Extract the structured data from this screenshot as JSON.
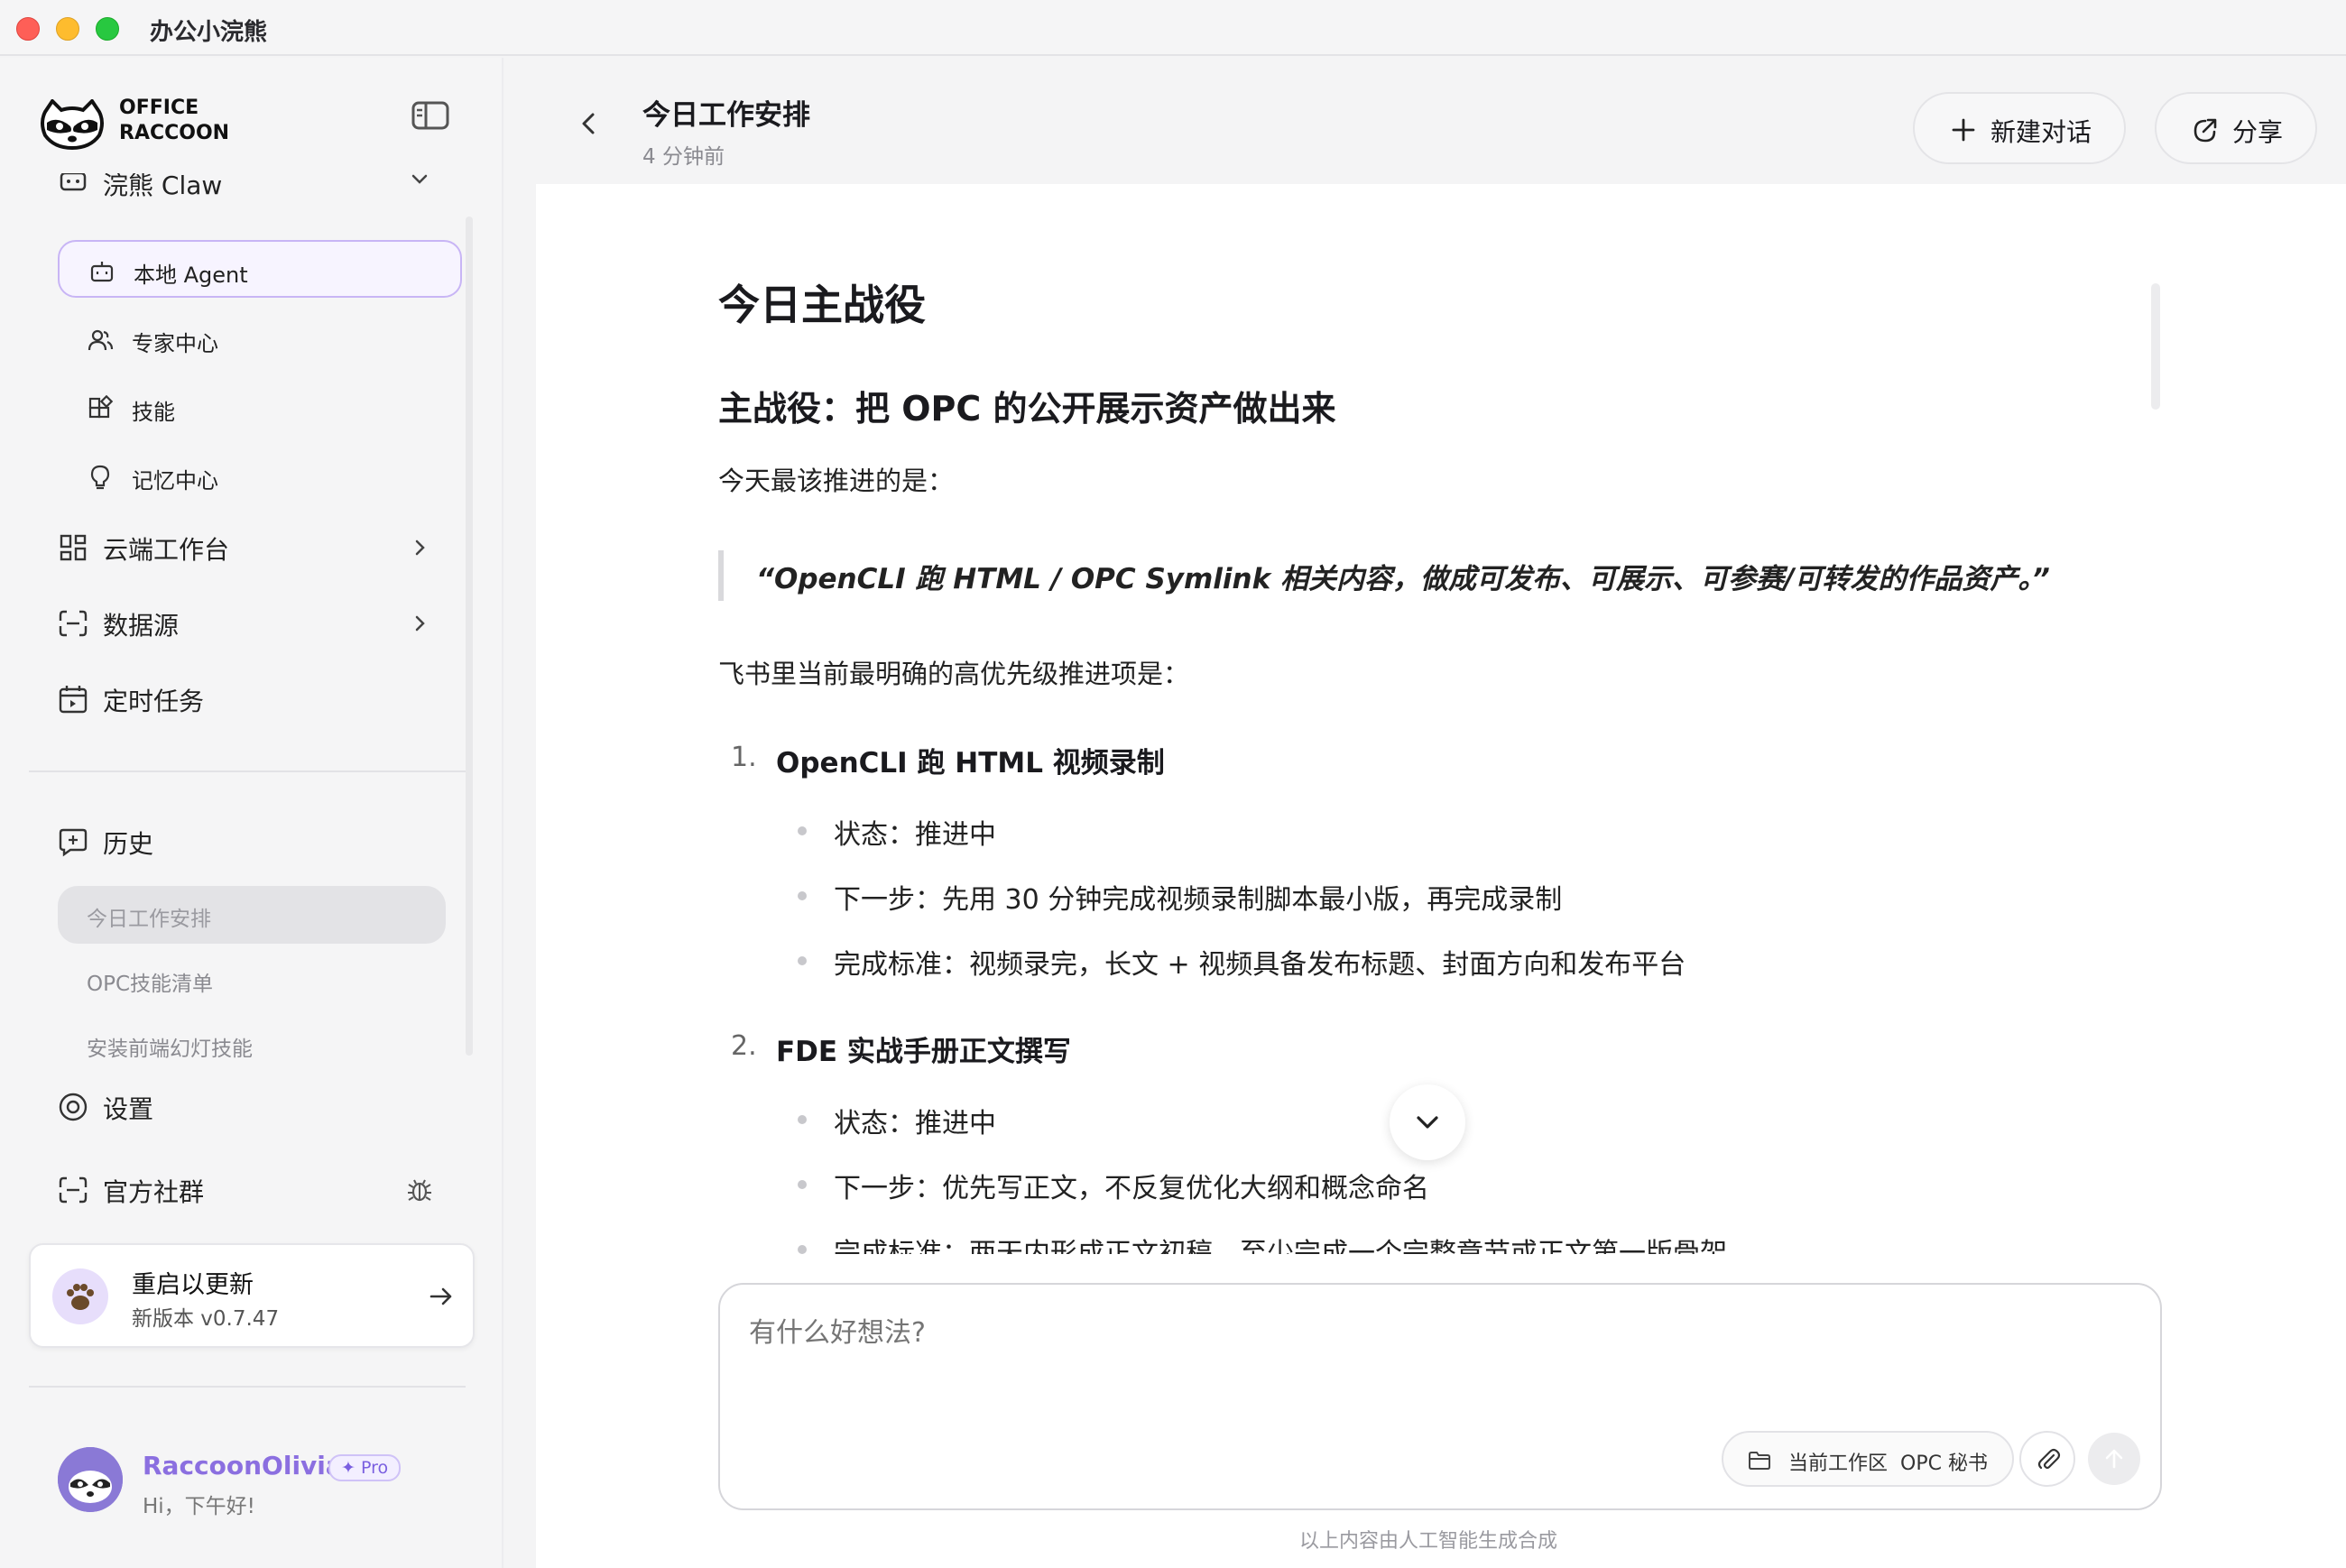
{
  "window": {
    "title": "办公小浣熊"
  },
  "sidebar": {
    "logo": {
      "line1": "OFFICE",
      "line2": "RACCOON"
    },
    "claw": {
      "label": "浣熊 Claw"
    },
    "claw_items": [
      {
        "label": "本地 Agent",
        "icon": "bot-icon",
        "active": true
      },
      {
        "label": "专家中心",
        "icon": "users-icon"
      },
      {
        "label": "技能",
        "icon": "skills-icon"
      },
      {
        "label": "记忆中心",
        "icon": "bulb-icon"
      }
    ],
    "nav": [
      {
        "label": "云端工作台",
        "icon": "grid-icon",
        "chevron": true
      },
      {
        "label": "数据源",
        "icon": "data-source-icon",
        "chevron": true
      },
      {
        "label": "定时任务",
        "icon": "calendar-icon",
        "chevron": false
      }
    ],
    "history": {
      "label": "历史",
      "items": [
        {
          "label": "今日工作安排",
          "active": true
        },
        {
          "label": "OPC技能清单"
        },
        {
          "label": "安装前端幻灯技能"
        }
      ]
    },
    "settings": {
      "label": "设置"
    },
    "community": {
      "label": "官方社群"
    },
    "update": {
      "title": "重启以更新",
      "subtitle": "新版本 v0.7.47"
    },
    "user": {
      "name": "RaccoonOlivia",
      "badge": "Pro",
      "greeting": "Hi，下午好!"
    }
  },
  "chat": {
    "title": "今日工作安排",
    "time": "4 分钟前",
    "new_chat": "新建对话",
    "share": "分享"
  },
  "message": {
    "h1": "今日主战役",
    "h2": "主战役：把 OPC 的公开展示资产做出来",
    "intro": "今天最该推进的是：",
    "quote": "“OpenCLI 跑 HTML / OPC Symlink 相关内容，做成可发布、可展示、可参赛/可转发的作品资产。”",
    "lead": "飞书里当前最明确的高优先级推进项是：",
    "items": [
      {
        "num": "1.",
        "title": "OpenCLI 跑 HTML 视频录制",
        "bullets": [
          "状态：推进中",
          "下一步：先用 30 分钟完成视频录制脚本最小版，再完成录制",
          "完成标准：视频录完，长文 + 视频具备发布标题、封面方向和发布平台"
        ]
      },
      {
        "num": "2.",
        "title": "FDE 实战手册正文撰写",
        "bullets": [
          "状态：推进中",
          "下一步：优先写正文，不反复优化大纲和概念命名",
          "完成标准：两天内形成正文初稿，至少完成一个完整章节或正文第一版骨架"
        ]
      }
    ]
  },
  "input": {
    "placeholder": "有什么好想法?",
    "workspace_label": "当前工作区",
    "workspace_value": "OPC 秘书"
  },
  "disclaimer": "以上内容由人工智能生成合成"
}
